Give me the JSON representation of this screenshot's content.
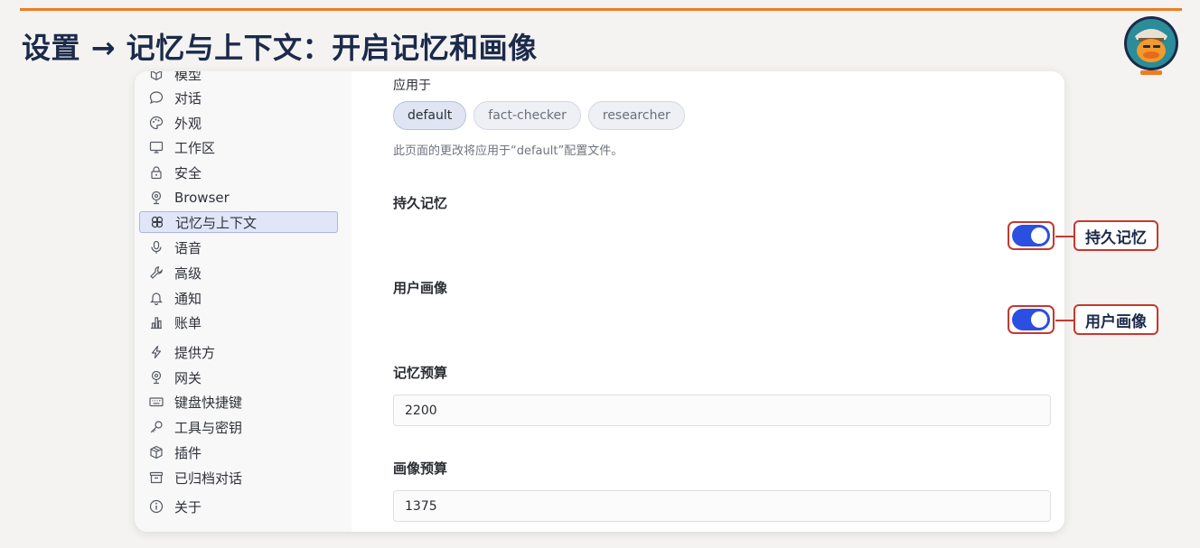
{
  "slide": {
    "title": "设置 → 记忆与上下文：开启记忆和画像",
    "accent_color": "#ee7d22",
    "title_color": "#1b2a4a"
  },
  "logo": {
    "icon": "duck-mascot-icon"
  },
  "sidebar": {
    "items": [
      {
        "label": "模型",
        "icon": "cube-icon"
      },
      {
        "label": "对话",
        "icon": "chat-bubble-icon"
      },
      {
        "label": "外观",
        "icon": "palette-icon"
      },
      {
        "label": "工作区",
        "icon": "monitor-icon"
      },
      {
        "label": "安全",
        "icon": "lock-icon"
      },
      {
        "label": "Browser",
        "icon": "globe-stand-icon"
      },
      {
        "label": "记忆与上下文",
        "icon": "brain-icon",
        "active": true
      },
      {
        "label": "语音",
        "icon": "microphone-icon"
      },
      {
        "label": "高级",
        "icon": "wrench-icon"
      },
      {
        "label": "通知",
        "icon": "bell-icon"
      },
      {
        "label": "账单",
        "icon": "bar-chart-icon"
      },
      {
        "label": "提供方",
        "icon": "lightning-icon"
      },
      {
        "label": "网关",
        "icon": "globe-stand-icon"
      },
      {
        "label": "键盘快捷键",
        "icon": "keyboard-icon"
      },
      {
        "label": "工具与密钥",
        "icon": "key-icon"
      },
      {
        "label": "插件",
        "icon": "package-icon"
      },
      {
        "label": "已归档对话",
        "icon": "archive-icon"
      },
      {
        "label": "关于",
        "icon": "info-icon"
      }
    ]
  },
  "main": {
    "apply_to_label": "应用于",
    "profiles": [
      "default",
      "fact-checker",
      "researcher"
    ],
    "selected_profile": "default",
    "hint": "此页面的更改将应用于“default”配置文件。",
    "persistent_memory": {
      "title": "持久记忆",
      "enabled": true
    },
    "user_profile": {
      "title": "用户画像",
      "enabled": true
    },
    "memory_budget": {
      "title": "记忆预算",
      "value": "2200"
    },
    "profile_budget": {
      "title": "画像预算",
      "value": "1375"
    },
    "toggle_color": "#2b4fe0"
  },
  "callouts": {
    "persistent_memory": "持久记忆",
    "user_profile": "用户画像",
    "color": "#c6382e"
  }
}
